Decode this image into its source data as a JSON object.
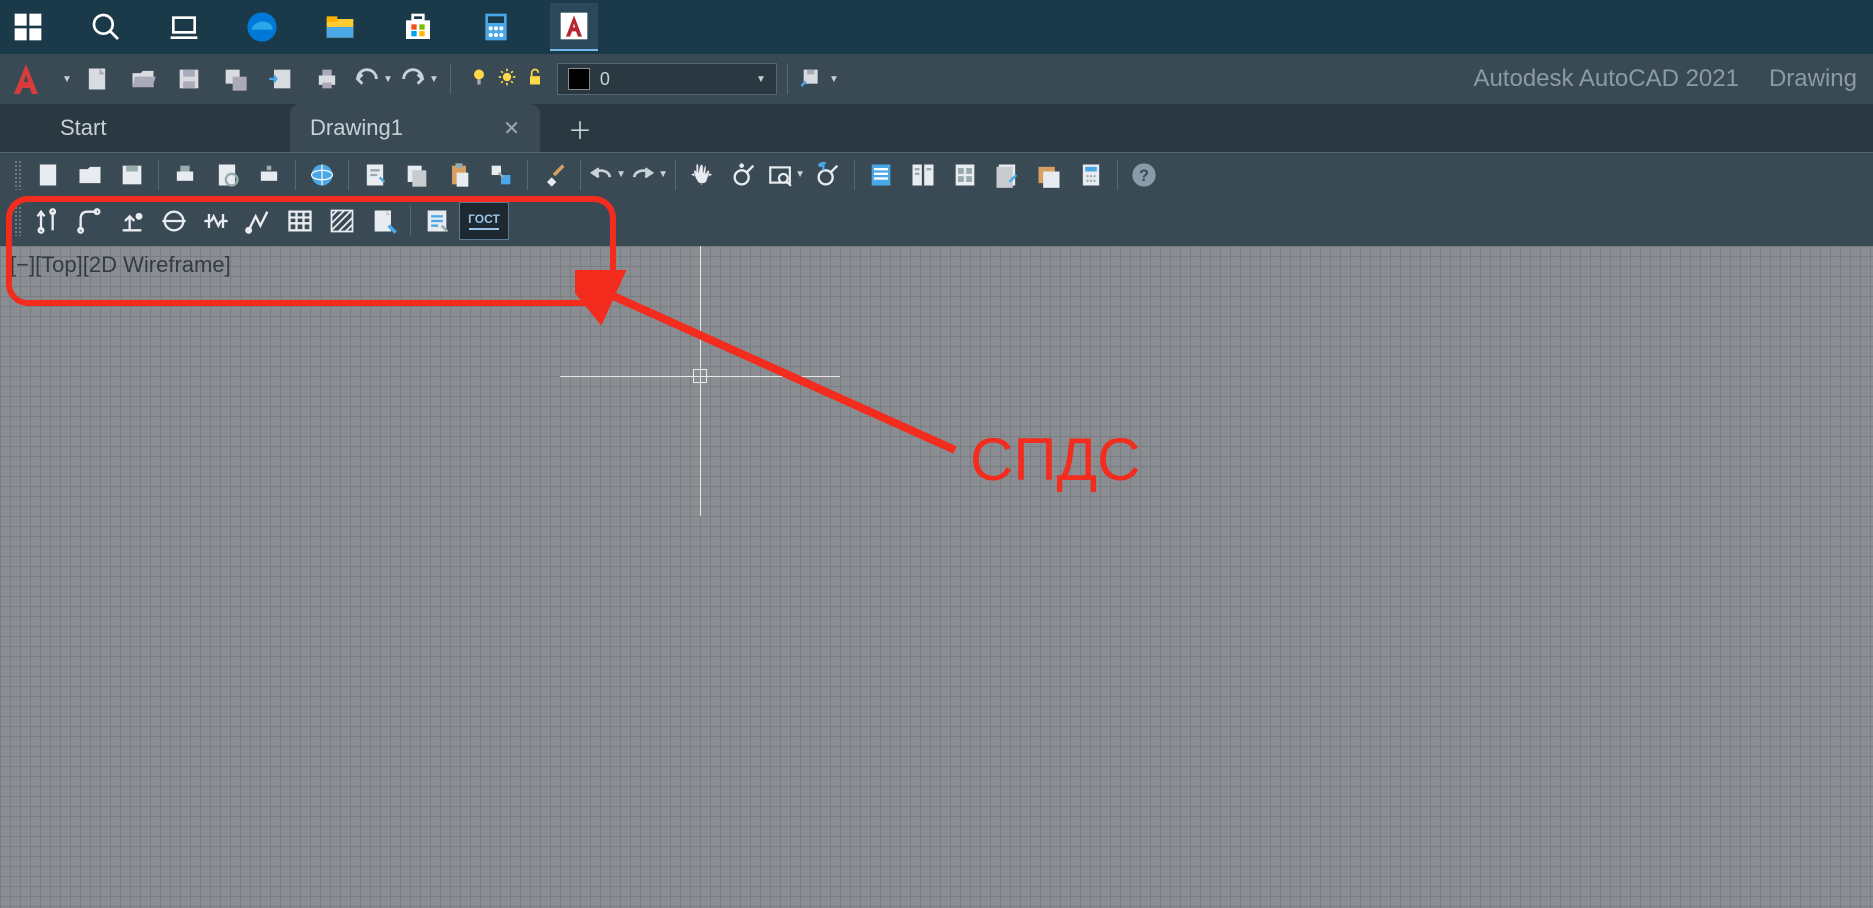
{
  "taskbar": {
    "items": [
      "windows-start",
      "search",
      "task-view",
      "edge",
      "file-explorer",
      "microsoft-store",
      "calculator",
      "autocad"
    ]
  },
  "titlebar": {
    "app_name": "Autodesk AutoCAD 2021",
    "doc_name": "Drawing",
    "layer_value": "0"
  },
  "tabs": {
    "start": "Start",
    "drawing": "Drawing1"
  },
  "viewport": {
    "label": "[−][Top][2D Wireframe]"
  },
  "annotation": {
    "label": "СПДС"
  },
  "spds_toolbar": {
    "gost": "ГОСТ"
  }
}
